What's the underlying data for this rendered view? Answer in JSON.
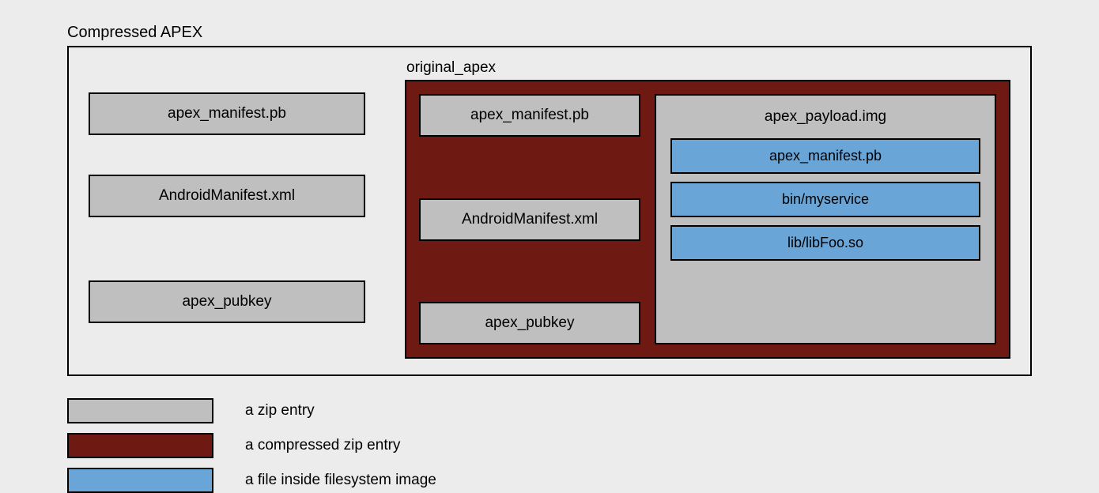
{
  "title": "Compressed APEX",
  "left_entries": [
    "apex_manifest.pb",
    "AndroidManifest.xml",
    "apex_pubkey"
  ],
  "original_label": "original_apex",
  "inner_left_entries": [
    "apex_manifest.pb",
    "AndroidManifest.xml",
    "apex_pubkey"
  ],
  "payload_title": "apex_payload.img",
  "payload_files": [
    "apex_manifest.pb",
    "bin/myservice",
    "lib/libFoo.so"
  ],
  "legend": {
    "gray": "a zip entry",
    "brown": "a compressed zip entry",
    "blue": "a file inside filesystem image"
  }
}
